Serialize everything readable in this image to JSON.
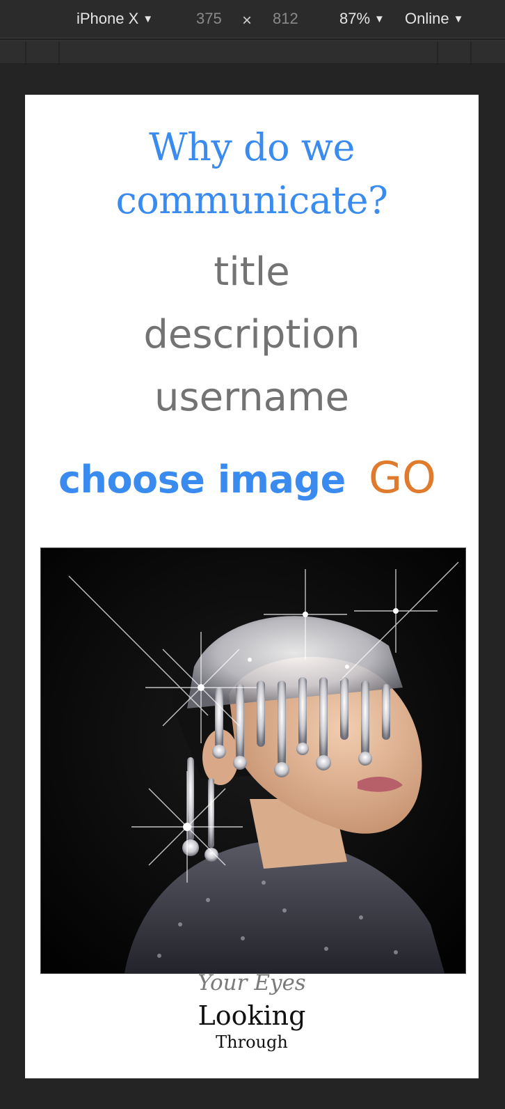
{
  "devtools": {
    "device": "iPhone X",
    "width": "375",
    "times": "×",
    "height": "812",
    "zoom": "87%",
    "network": "Online"
  },
  "page": {
    "heading": "Why do we communicate?",
    "fields": {
      "title": "title",
      "description": "description",
      "username": "username"
    },
    "choose_image": "choose image",
    "go": "GO",
    "caption": {
      "italic": "Your Eyes",
      "big": "Looking",
      "small": "Through"
    }
  },
  "colors": {
    "accent_blue": "#3a8bef",
    "accent_orange": "#e07a2c",
    "field_gray": "#737373"
  }
}
